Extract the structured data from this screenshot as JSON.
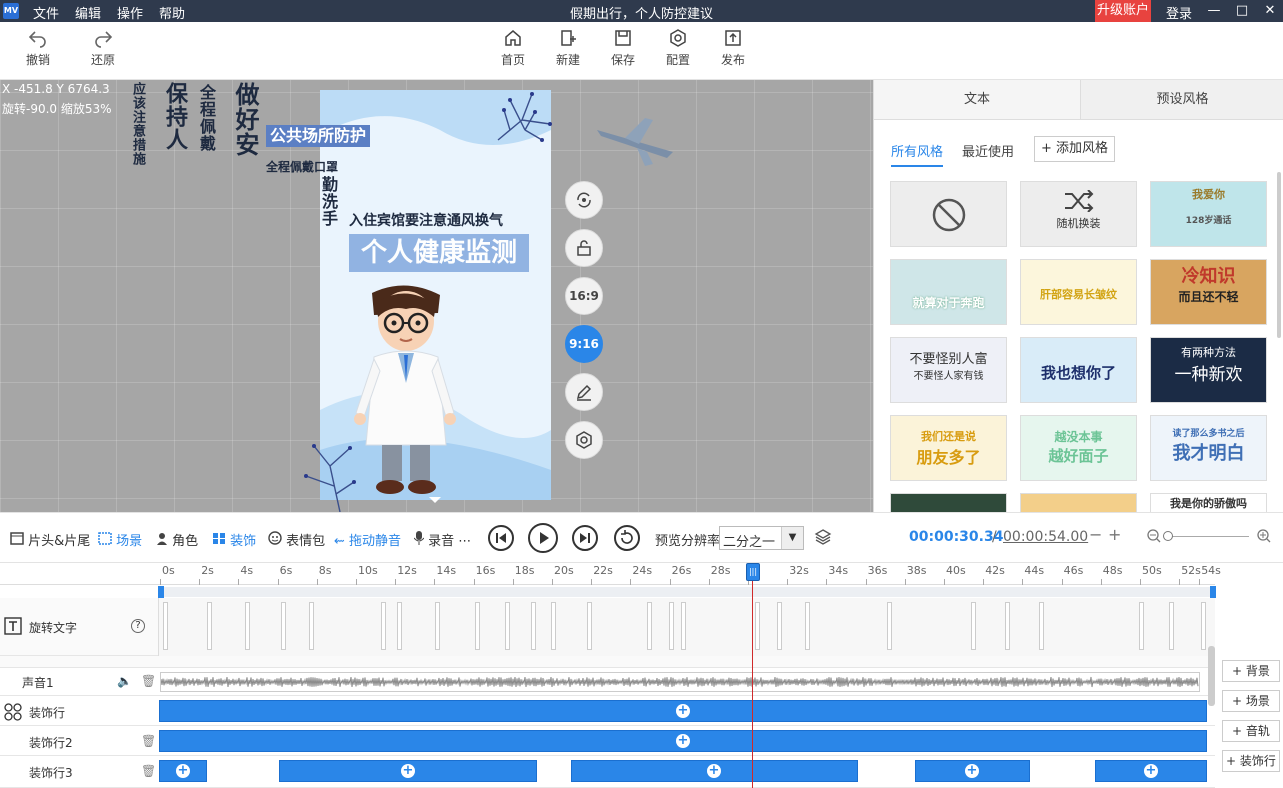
{
  "app": {
    "logo": "MV",
    "title": "假期出行，个人防控建议"
  },
  "menu": [
    "文件",
    "编辑",
    "操作",
    "帮助"
  ],
  "account": {
    "upgrade": "升级账户",
    "login": "登录"
  },
  "toolbar": {
    "undo": "撤销",
    "redo": "还原",
    "home": "首页",
    "new": "新建",
    "save": "保存",
    "config": "配置",
    "publish": "发布"
  },
  "canvas": {
    "coords": "X -451.8 Y 6764.3",
    "transform": "旋转-90.0 缩放53%",
    "side_buttons": [
      "16:9",
      "9:16"
    ],
    "texts": {
      "t1": "应该注意措施",
      "t2": "保持人",
      "t3": "全程佩戴",
      "t4": "做好安",
      "t5": "公共场所防护",
      "t6": "全程佩戴口罩",
      "t7": "勤洗手",
      "t8": "入住宾馆要注意通风换气",
      "t9": "个人健康监测"
    }
  },
  "right_panel": {
    "tabs": [
      "文本",
      "预设风格"
    ],
    "subtabs": [
      "所有风格",
      "最近使用"
    ],
    "add_style": "添加风格",
    "random": "随机换装",
    "styles": [
      "我爱你",
      "128岁通话",
      "就算对于奔跑",
      "肝部容易长皱纹",
      "冷知识",
      "而且还不轻",
      "不要怪别人富",
      "不要怪人家有钱",
      "我也想你了",
      "有两种方法",
      "一种新欢",
      "我们还是说",
      "朋友多了",
      "越没本事",
      "越好面子",
      "读了那么多书之后",
      "我才明白",
      "我是你的骄傲吗"
    ]
  },
  "controls": {
    "tabs": [
      "片头&片尾",
      "场景",
      "角色",
      "装饰",
      "表情包",
      "拖动静音",
      "录音"
    ],
    "resolution_label": "预览分辨率",
    "resolution": "二分之一",
    "time_current": "00:00:30.34",
    "time_total": "00:00:54.00",
    "time_sep": "/"
  },
  "ruler": [
    "0s",
    "2s",
    "4s",
    "6s",
    "8s",
    "10s",
    "12s",
    "14s",
    "16s",
    "18s",
    "20s",
    "22s",
    "24s",
    "26s",
    "28s",
    "3",
    "32s",
    "34s",
    "36s",
    "38s",
    "40s",
    "42s",
    "44s",
    "46s",
    "48s",
    "50s",
    "52s",
    "54s"
  ],
  "tracks": {
    "rotate_text": "旋转文字",
    "sound": "声音1",
    "deco": "装饰行",
    "deco2": "装饰行2",
    "deco3": "装饰行3"
  },
  "add_buttons": [
    "背景",
    "场景",
    "音轨",
    "装饰行"
  ],
  "colors": {
    "accent": "#2a86e8",
    "upgrade": "#e8433f",
    "titlebar": "#2f3a4d"
  }
}
